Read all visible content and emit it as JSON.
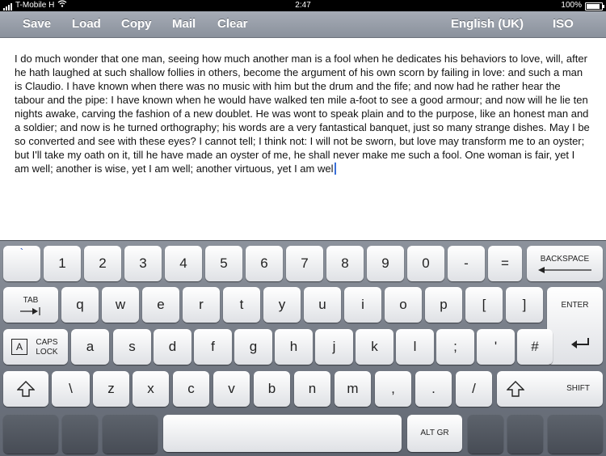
{
  "status_bar": {
    "carrier": "T-Mobile H",
    "time": "2:47",
    "battery": "100%",
    "battery_level": 1.0
  },
  "toolbar": {
    "save": "Save",
    "load": "Load",
    "copy": "Copy",
    "mail": "Mail",
    "clear": "Clear",
    "language": "English (UK)",
    "layout": "ISO"
  },
  "document": {
    "text": "I do much wonder that one man, seeing how much another man is a fool when he dedicates his behaviors to love, will, after he hath laughed at such shallow follies in others, become the argument of his own scorn by failing in love: and such a man is Claudio. I have known when there was no music with him but the drum and the fife; and now had he rather hear the tabour and the pipe: I have known when he would have walked ten mile a-foot to see a good armour; and now will he lie ten nights awake, carving the fashion of a new doublet. He was wont to speak plain and to the purpose, like an honest man and a soldier; and now is he turned orthography; his words are a very fantastical banquet, just so many strange dishes. May I be so converted and see with these eyes? I cannot tell; I think not: I will not be sworn, but love may transform me to an oyster; but I'll take my oath on it, till he have made an oyster of me, he shall never make me such a fool. One woman is fair, yet I am well; another is wise, yet I am well; another virtuous, yet I am wel"
  },
  "keyboard": {
    "row1": [
      "`",
      "1",
      "2",
      "3",
      "4",
      "5",
      "6",
      "7",
      "8",
      "9",
      "0",
      "-",
      "="
    ],
    "backspace": "BACKSPACE",
    "tab": "TAB",
    "row2": [
      "q",
      "w",
      "e",
      "r",
      "t",
      "y",
      "u",
      "i",
      "o",
      "p",
      "[",
      "]"
    ],
    "enter": "ENTER",
    "caps_box": "A",
    "caps_line1": "CAPS",
    "caps_line2": "LOCK",
    "row3": [
      "a",
      "s",
      "d",
      "f",
      "g",
      "h",
      "j",
      "k",
      "l",
      ";",
      "'",
      "#"
    ],
    "row4": [
      "\\",
      "z",
      "x",
      "c",
      "v",
      "b",
      "n",
      "m",
      ",",
      ".",
      "/"
    ],
    "shift": "SHIFT",
    "altgr": "ALT GR"
  }
}
